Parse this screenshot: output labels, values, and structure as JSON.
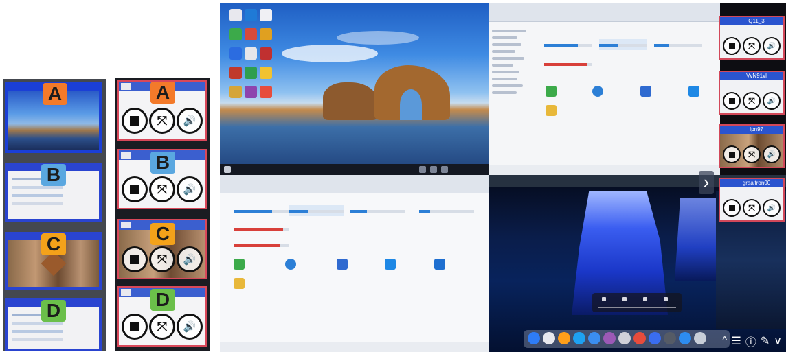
{
  "source_panel": {
    "labels": [
      "A",
      "B",
      "C",
      "D"
    ]
  },
  "control_panel": {
    "labels": [
      "A",
      "B",
      "C",
      "D"
    ],
    "buttons": {
      "stop": "■",
      "fullscreen": "⤧",
      "volume": "🔊"
    }
  },
  "wall_side_tiles": [
    {
      "name": "Q11_3"
    },
    {
      "name": "VvN91vl"
    },
    {
      "name": "Ipn97"
    },
    {
      "name": "graaltron00"
    }
  ],
  "wall": {
    "next_arrow": "›",
    "corner_controls": [
      "^",
      "☰",
      "ⓘ",
      "✎",
      "∨"
    ]
  },
  "colors": {
    "label_a": "#f37a2a",
    "label_b": "#5aa7e0",
    "label_c": "#f4a21a",
    "label_d": "#6bbf4a",
    "tile_border": "#d8485a",
    "title_bar": "#2a54cf"
  }
}
